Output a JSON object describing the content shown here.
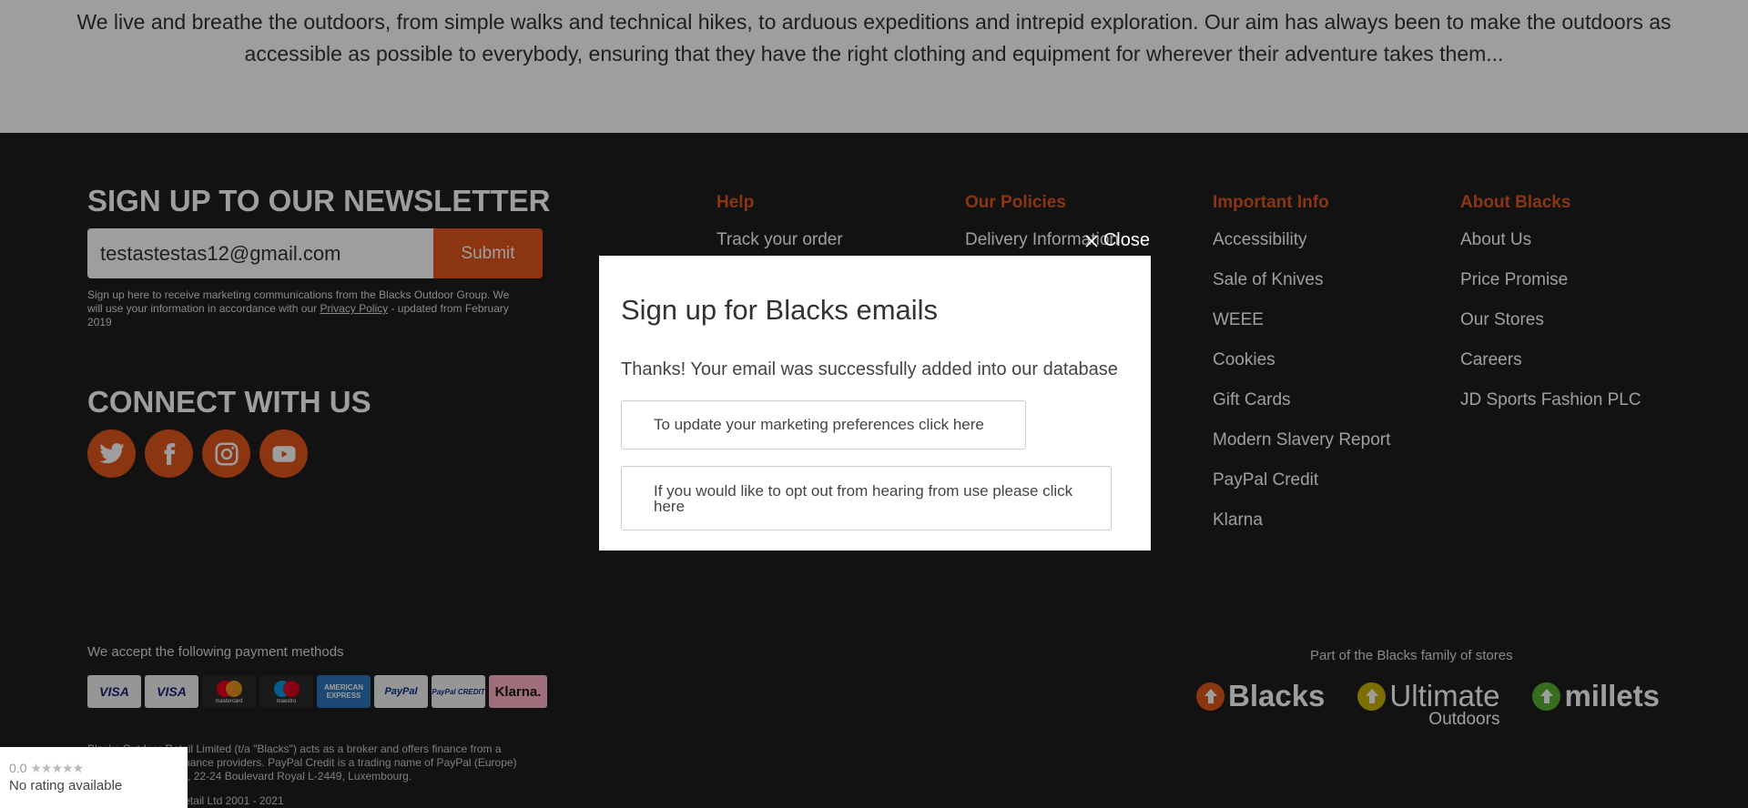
{
  "about": {
    "text": "We live and breathe the outdoors, from simple walks and technical hikes, to arduous expeditions and intrepid exploration. Our aim has always been to make the outdoors as accessible as possible to everybody, ensuring that they have the right clothing and equipment for wherever their adventure takes them..."
  },
  "newsletter": {
    "title": "SIGN UP TO OUR NEWSLETTER",
    "email_value": "testastestas12@gmail.com",
    "submit_label": "Submit",
    "small_text_1": "Sign up here to receive marketing communications from the Blacks Outdoor Group. We will use your information in accordance with our ",
    "privacy_link": "Privacy Policy",
    "small_text_2": " - updated from February 2019"
  },
  "connect": {
    "title": "CONNECT WITH US",
    "icons": [
      "twitter-icon",
      "facebook-icon",
      "instagram-icon",
      "youtube-icon"
    ]
  },
  "columns": [
    {
      "title": "Help",
      "items": [
        "Track your order"
      ]
    },
    {
      "title": "Our Policies",
      "items": [
        "Delivery Information"
      ]
    },
    {
      "title": "Important Info",
      "items": [
        "Accessibility",
        "Sale of Knives",
        "WEEE",
        "Cookies",
        "Gift Cards",
        "Modern Slavery Report",
        "PayPal Credit",
        "Klarna"
      ]
    },
    {
      "title": "About Blacks",
      "items": [
        "About Us",
        "Price Promise",
        "Our Stores",
        "Careers",
        "JD Sports Fashion PLC"
      ]
    }
  ],
  "payments": {
    "label": "We accept the following payment methods",
    "cards": [
      "VISA",
      "VISA",
      "mastercard",
      "maestro",
      "AMERICAN EXPRESS",
      "PayPal",
      "PayPal CREDIT",
      "Klarna."
    ]
  },
  "legal": {
    "text": "Blacks Outdoor Retail Limited (t/a \"Blacks\") acts as a broker and offers finance from a restricted range of finance providers. PayPal Credit is a trading name of PayPal (Europe) S.à r.l. et Cie, S.C.A., 22-24 Boulevard Royal L-2449, Luxembourg.",
    "copyright": "© Blacks Outdoor Retail Ltd 2001 - 2021"
  },
  "family": {
    "label": "Part of the Blacks family of stores",
    "brands": [
      "Blacks",
      "Ultimate",
      "millets"
    ],
    "ultimate_sub": "Outdoors"
  },
  "trust_badge": {
    "score": "0.0",
    "stars": "★★★★★",
    "text": "No rating available"
  },
  "modal": {
    "close_label": "Close",
    "title": "Sign up for Blacks emails",
    "message": "Thanks! Your email was successfully added into our database",
    "prefs_button": "To update your marketing preferences click here",
    "optout_button": "If you would like to opt out from hearing from use please click here"
  },
  "colors": {
    "accent": "#e0561c",
    "footer_bg": "#1e1e1e",
    "overlay": "rgba(0,0,0,0.38)"
  }
}
